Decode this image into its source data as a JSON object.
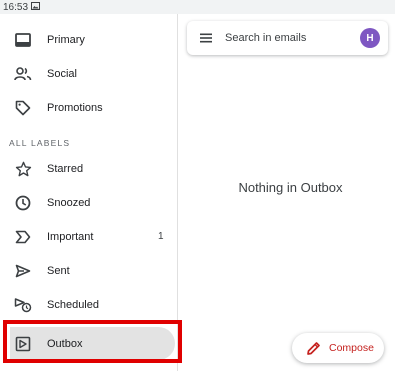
{
  "status_bar": {
    "time": "16:53",
    "notification_icon": "image-icon"
  },
  "drawer": {
    "items_top": [
      {
        "label": "Primary",
        "icon": "inbox-icon"
      },
      {
        "label": "Social",
        "icon": "people-icon"
      },
      {
        "label": "Promotions",
        "icon": "tag-icon"
      }
    ],
    "section_header": "ALL LABELS",
    "items_labels": [
      {
        "label": "Starred",
        "icon": "star-icon"
      },
      {
        "label": "Snoozed",
        "icon": "clock-icon"
      },
      {
        "label": "Important",
        "icon": "important-icon",
        "count": "1"
      },
      {
        "label": "Sent",
        "icon": "send-icon"
      },
      {
        "label": "Scheduled",
        "icon": "scheduled-send-icon"
      },
      {
        "label": "Outbox",
        "icon": "outbox-icon",
        "selected": true
      }
    ]
  },
  "search": {
    "placeholder": "Search in emails",
    "avatar_letter": "H",
    "avatar_color": "#7e57c2"
  },
  "main": {
    "empty_message": "Nothing in Outbox"
  },
  "compose": {
    "label": "Compose",
    "accent_color": "#c5221f"
  },
  "highlight_color": "#e00000"
}
